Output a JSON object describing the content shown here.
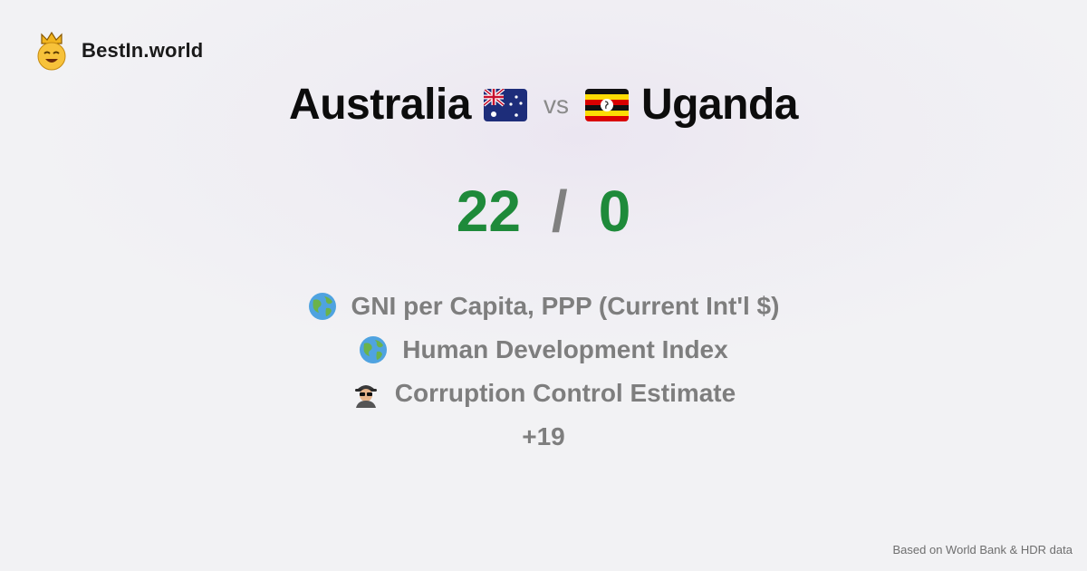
{
  "brand": {
    "name": "BestIn.world",
    "logo_icon": "crown-smiley-icon"
  },
  "comparison": {
    "country_a": "Australia",
    "country_a_flag": "australia-flag-icon",
    "vs_label": "vs",
    "country_b": "Uganda",
    "country_b_flag": "uganda-flag-icon"
  },
  "score": {
    "a": "22",
    "separator": "/",
    "b": "0",
    "color": "#1e8a3a"
  },
  "metrics": [
    {
      "icon": "globe-icon",
      "label": "GNI per Capita, PPP (Current Int'l $)"
    },
    {
      "icon": "globe-icon",
      "label": "Human Development Index"
    },
    {
      "icon": "spy-icon",
      "label": "Corruption Control Estimate"
    }
  ],
  "more_label": "+19",
  "footer": "Based on World Bank & HDR data"
}
